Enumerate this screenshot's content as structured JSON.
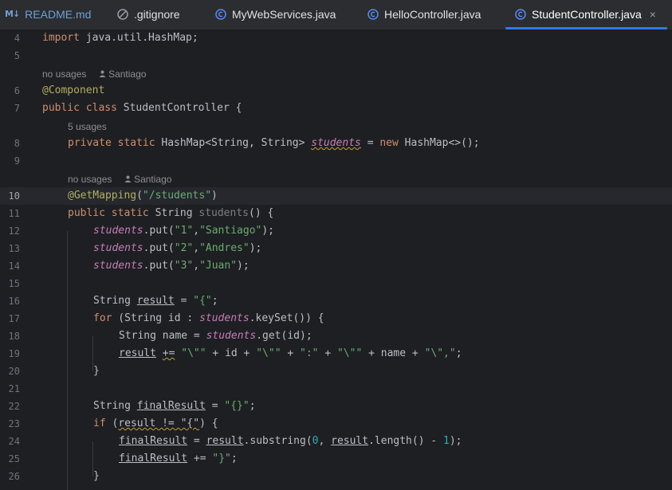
{
  "tabs": [
    {
      "label": "README.md",
      "icon": "markdown-icon"
    },
    {
      "label": ".gitignore",
      "icon": "ignore-icon"
    },
    {
      "label": "MyWebServices.java",
      "icon": "java-class-icon"
    },
    {
      "label": "HelloController.java",
      "icon": "java-class-icon"
    },
    {
      "label": "StudentController.java",
      "icon": "java-class-icon",
      "active": true
    }
  ],
  "tab_close": "×",
  "line_numbers": [
    "4",
    "5",
    "6",
    "7",
    "8",
    "9",
    "10",
    "11",
    "12",
    "13",
    "14",
    "15",
    "16",
    "17",
    "18",
    "19",
    "20",
    "21",
    "22",
    "23",
    "24",
    "25",
    "26"
  ],
  "current_line": "10",
  "inlay_hints": {
    "class_usages": "no usages",
    "class_author": "Santiago",
    "field_usages": "5 usages",
    "method_usages": "no usages",
    "method_author": "Santiago"
  },
  "code": {
    "l4": [
      "import",
      " java.util.HashMap;"
    ],
    "l6": [
      "@Component"
    ],
    "l7": [
      "public class",
      " StudentController",
      " {"
    ],
    "l8": [
      "private static",
      " HashMap<String, String> ",
      "students",
      " = ",
      "new",
      " HashMap<>();"
    ],
    "l10": [
      "@GetMapping",
      "(",
      "\"/students\"",
      ")"
    ],
    "l11": [
      "public static",
      " String ",
      "students",
      "() {"
    ],
    "l12": [
      "students",
      ".put(",
      "\"1\"",
      ",",
      "\"Santiago\"",
      ");"
    ],
    "l13": [
      "students",
      ".put(",
      "\"2\"",
      ",",
      "\"Andres\"",
      ");"
    ],
    "l14": [
      "students",
      ".put(",
      "\"3\"",
      ",",
      "\"Juan\"",
      ");"
    ],
    "l16": [
      "String ",
      "result",
      " = ",
      "\"{\"",
      ";"
    ],
    "l17": [
      "for",
      " (String id : ",
      "students",
      ".keySet()) {"
    ],
    "l18": [
      "String name = ",
      "students",
      ".get(id);"
    ],
    "l19": [
      "result",
      " ",
      "+=",
      " ",
      "\"\\\"\"",
      " + id + ",
      "\"\\\"\"",
      " + ",
      "\":\"",
      " + ",
      "\"\\\"\"",
      " + name + ",
      "\"\\\",\"",
      ";"
    ],
    "l20": [
      "}"
    ],
    "l22": [
      "String ",
      "finalResult",
      " = ",
      "\"{}\"",
      ";"
    ],
    "l23": [
      "if",
      " (",
      "result != \"{\"",
      ") {"
    ],
    "l24": [
      "finalResult",
      " = ",
      "result",
      ".substring(",
      "0",
      ", ",
      "result",
      ".length() - ",
      "1",
      ");"
    ],
    "l25": [
      "finalResult",
      " += ",
      "\"}\"",
      ";"
    ],
    "l26": [
      "}"
    ]
  }
}
